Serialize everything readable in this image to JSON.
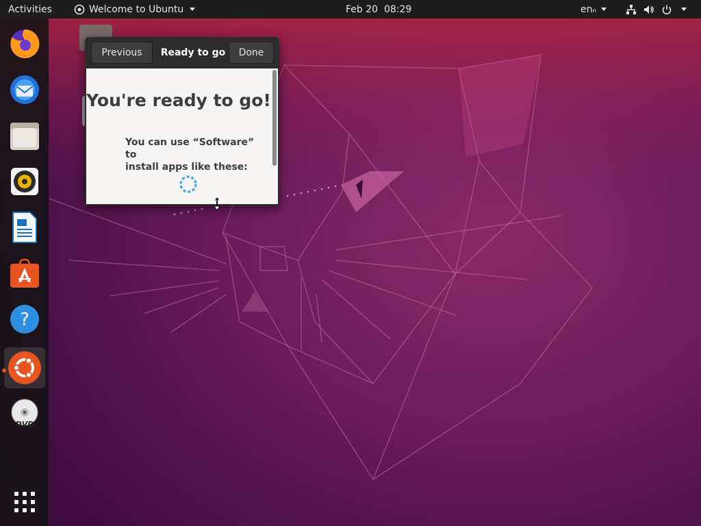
{
  "topbar": {
    "activities": "Activities",
    "app_menu": "Welcome to Ubuntu",
    "clock": "Feb 20  08:29",
    "lang": "enₙ"
  },
  "dock": {
    "items": [
      "firefox-icon",
      "thunderbird-icon",
      "files-icon",
      "rhythmbox-icon",
      "libreoffice-writer-icon",
      "ubuntu-software-icon",
      "help-icon",
      "ubuntu-welcome-icon",
      "dvd-icon",
      "show-apps-icon"
    ]
  },
  "dialog": {
    "previous": "Previous",
    "title": "Ready to go",
    "done": "Done",
    "heading": "You're ready to go!",
    "subtext_line1": "You can use “Software” to",
    "subtext_line2": "install apps like these:"
  },
  "colors": {
    "accent": "#e95420",
    "topbar": "#1d1d1d",
    "spinner": "#3daee9"
  }
}
